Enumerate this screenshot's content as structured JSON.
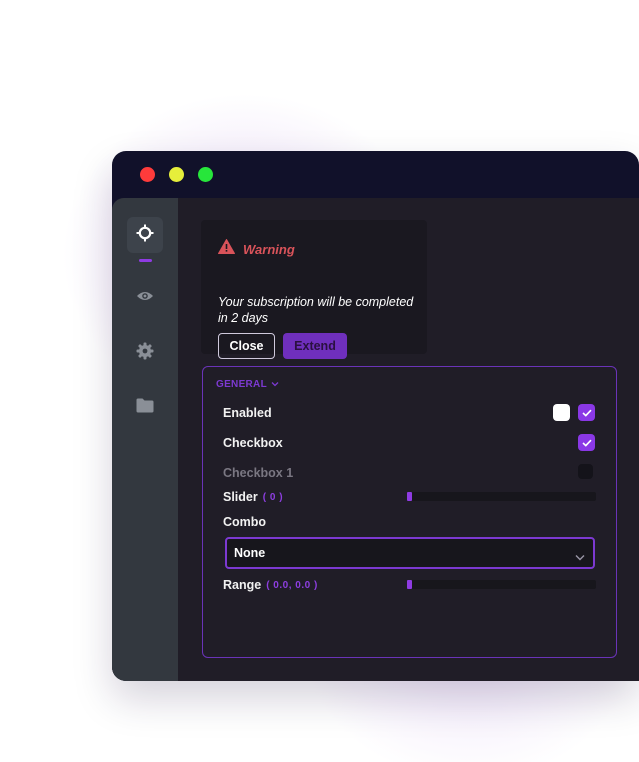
{
  "warning": {
    "title": "Warning",
    "message": "Your subscription will be completed in 2 days",
    "close_label": "Close",
    "extend_label": "Extend"
  },
  "sidebar": {
    "items": [
      {
        "icon": "crosshair-icon",
        "active": true
      },
      {
        "icon": "eye-icon",
        "active": false
      },
      {
        "icon": "gear-icon",
        "active": false
      },
      {
        "icon": "folder-icon",
        "active": false
      }
    ]
  },
  "panel": {
    "section_title": "GENERAL",
    "enabled_label": "Enabled",
    "checkbox_label": "Checkbox",
    "checkbox1_label": "Checkbox 1",
    "slider_label": "Slider",
    "slider_value": "( 0 )",
    "slider_fraction": 0,
    "combo_label": "Combo",
    "combo_value": "None",
    "range_label": "Range",
    "range_value": "( 0.0, 0.0 )",
    "range_fraction": [
      0,
      0
    ]
  },
  "colors": {
    "accent": "#8a38e6",
    "warning": "#d9535a",
    "window": "#11112a",
    "panel": "#201d27",
    "sidebar": "#33383f"
  }
}
